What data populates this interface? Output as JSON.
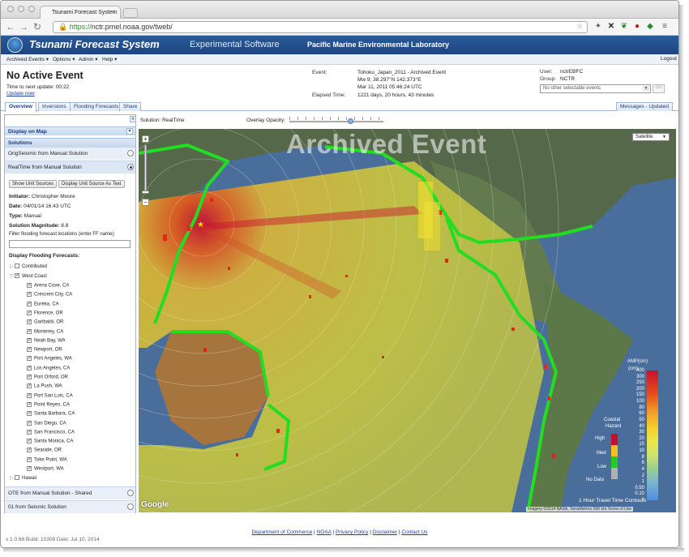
{
  "browser": {
    "tab_title": "Tsunami Forecast System",
    "url_scheme": "https://",
    "url_rest": "nctr.pmel.noaa.gov/tweb/"
  },
  "header": {
    "title": "Tsunami Forecast System",
    "subtitle": "Experimental Software",
    "lab": "Pacific Marine Environmental Laboratory"
  },
  "menu": {
    "items": [
      "Archived Events ▾",
      "Options ▾",
      "Admin ▾",
      "Help ▾"
    ],
    "logout": "Logout"
  },
  "info": {
    "status": "No Active Event",
    "next_update": "Time to next update: 00:22",
    "update_now": "Update now",
    "event_label": "Event:",
    "event_name": "Tohoku_Japan_2011 - Archived Event",
    "event_mag": "Mw 9; 38.297°N 142.373°E",
    "event_time": "Mar 11, 2011 05:46:24 UTC",
    "elapsed_label": "Elapsed Time:",
    "elapsed_value": "1221 days, 20 hours, 43 minutes",
    "user_label": "User:",
    "user_value": "nctrEBFC",
    "group_label": "Group:",
    "group_value": "NCTR",
    "event_select": "No other selectable events",
    "go": "Go"
  },
  "tabs": [
    "Overview",
    "Inversions",
    "Flooding Forecasts",
    "Share"
  ],
  "messages_tab": "Messages - Updated",
  "sidebar": {
    "display_on_map": "Display on Map",
    "solutions": "Solutions",
    "orig_seismic": "OrigSeismic from Manual Solution",
    "realtime": "RealTime from Manual Solution",
    "show_unit_sources": "Show Unit Sources",
    "display_unit_source": "Display Unit Source As Text",
    "initiator_label": "Initiator:",
    "initiator": "Christopher Moore",
    "date_label": "Date:",
    "date": "04/01/14 16:43 UTC",
    "type_label": "Type:",
    "type": "Manual",
    "magnitude_label": "Solution Magnitude:",
    "magnitude": "8.8",
    "filter_label": "Filter flooding forecast locations (enter FF name):",
    "display_flooding": "Display Flooding Forecasts:",
    "contributed": "Contributed",
    "west_coast": "West Coast",
    "hawaii": "Hawaii",
    "locations": [
      "Arena Cove, CA",
      "Crescent City, CA",
      "Eureka, CA",
      "Florence, OR",
      "Garibaldi, OR",
      "Monterey, CA",
      "Neah Bay, WA",
      "Newport, OR",
      "Port Angeles, WA",
      "Los Angeles, CA",
      "Port Orford, OR",
      "La Push, WA",
      "Port San Luis, CA",
      "Point Reyes, CA",
      "Santa Barbara, CA",
      "San Diego, CA",
      "San Francisco, CA",
      "Santa Monica, CA",
      "Seaside, OR",
      "Toke Point, WA",
      "Westport, WA"
    ],
    "ote": "OTE from Manual Solution - Shared",
    "seismic01": "01 from Seismic Solution"
  },
  "map": {
    "solution_label": "Solution: RealTime",
    "opacity_label": "Overlay Opacity:",
    "watermark": "Archived Event",
    "map_type": "Satellite",
    "amp_title": "AMP(cm)",
    "amp_unit": "(cm)",
    "amp_labels": [
      "400",
      "300",
      "250",
      "200",
      "150",
      "100",
      "80",
      "60",
      "50",
      "40",
      "30",
      "20",
      "15",
      "10",
      "8",
      "6",
      "4",
      "2",
      "1",
      "0.50",
      "0.10",
      "0"
    ],
    "hazard_title_1": "Coastal",
    "hazard_title_2": "Hazard",
    "hazard_labels": [
      "High",
      "Med",
      "Low",
      "No Data"
    ],
    "contours": "1 Hour Travel Time Contours",
    "google": "Google",
    "attribution": "Imagery ©2014 NASA, TerraMetrics   500 km   Terms of Use"
  },
  "colors": {
    "header_blue": "#1d4580",
    "ocean": "#c9c73a",
    "wave_high": "#c8102e",
    "coast_green": "#22dd22"
  },
  "footer": {
    "links": [
      "Department of Commerce",
      "NOAA",
      "Privacy Policy",
      "Disclaimer",
      "Contact Us"
    ],
    "version": "v 1.0.68 Build: 10308 Date: Jul 10, 2014"
  }
}
